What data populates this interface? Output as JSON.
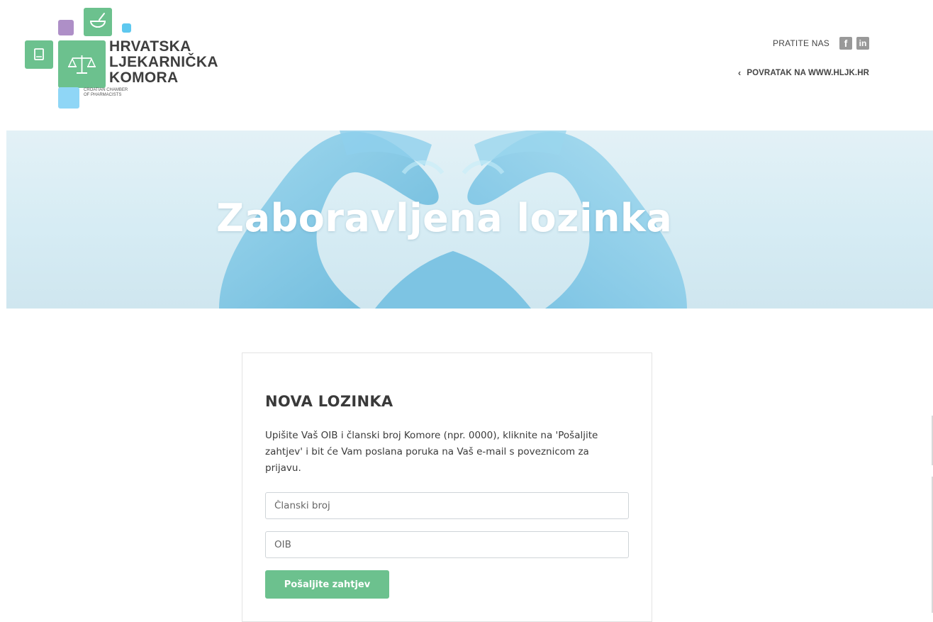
{
  "header": {
    "logo": {
      "word1": "HRVATSKA",
      "word2": "LJEKARNIČKA",
      "word3": "KOMORA",
      "subtitle_line1": "CROATIAN CHAMBER",
      "subtitle_line2": "OF PHARMACISTS"
    },
    "follow_label": "PRATITE NAS",
    "social": [
      {
        "name": "facebook-icon",
        "glyph": "f"
      },
      {
        "name": "linkedin-icon",
        "glyph": "in"
      }
    ],
    "back_link_label": "POVRATAK NA WWW.HLJK.HR"
  },
  "hero": {
    "title": "Zaboravljena lozinka"
  },
  "form": {
    "heading": "NOVA LOZINKA",
    "description": "Upišite Vaš OIB i članski broj Komore (npr. 0000), kliknite na 'Pošaljite zahtjev' i bit će Vam poslana poruka na Vaš e-mail s poveznicom za prijavu.",
    "member_number": {
      "value": "",
      "placeholder": "Članski broj"
    },
    "oib": {
      "value": "",
      "placeholder": "OIB"
    },
    "submit_label": "Pošaljite zahtjev"
  },
  "colors": {
    "brand_green": "#6cc18e",
    "brand_purple": "#ae8fc7",
    "brand_blue": "#5ec8ef",
    "glove_blue": "#7cc4e2",
    "text_dark": "#3a3a3a"
  }
}
